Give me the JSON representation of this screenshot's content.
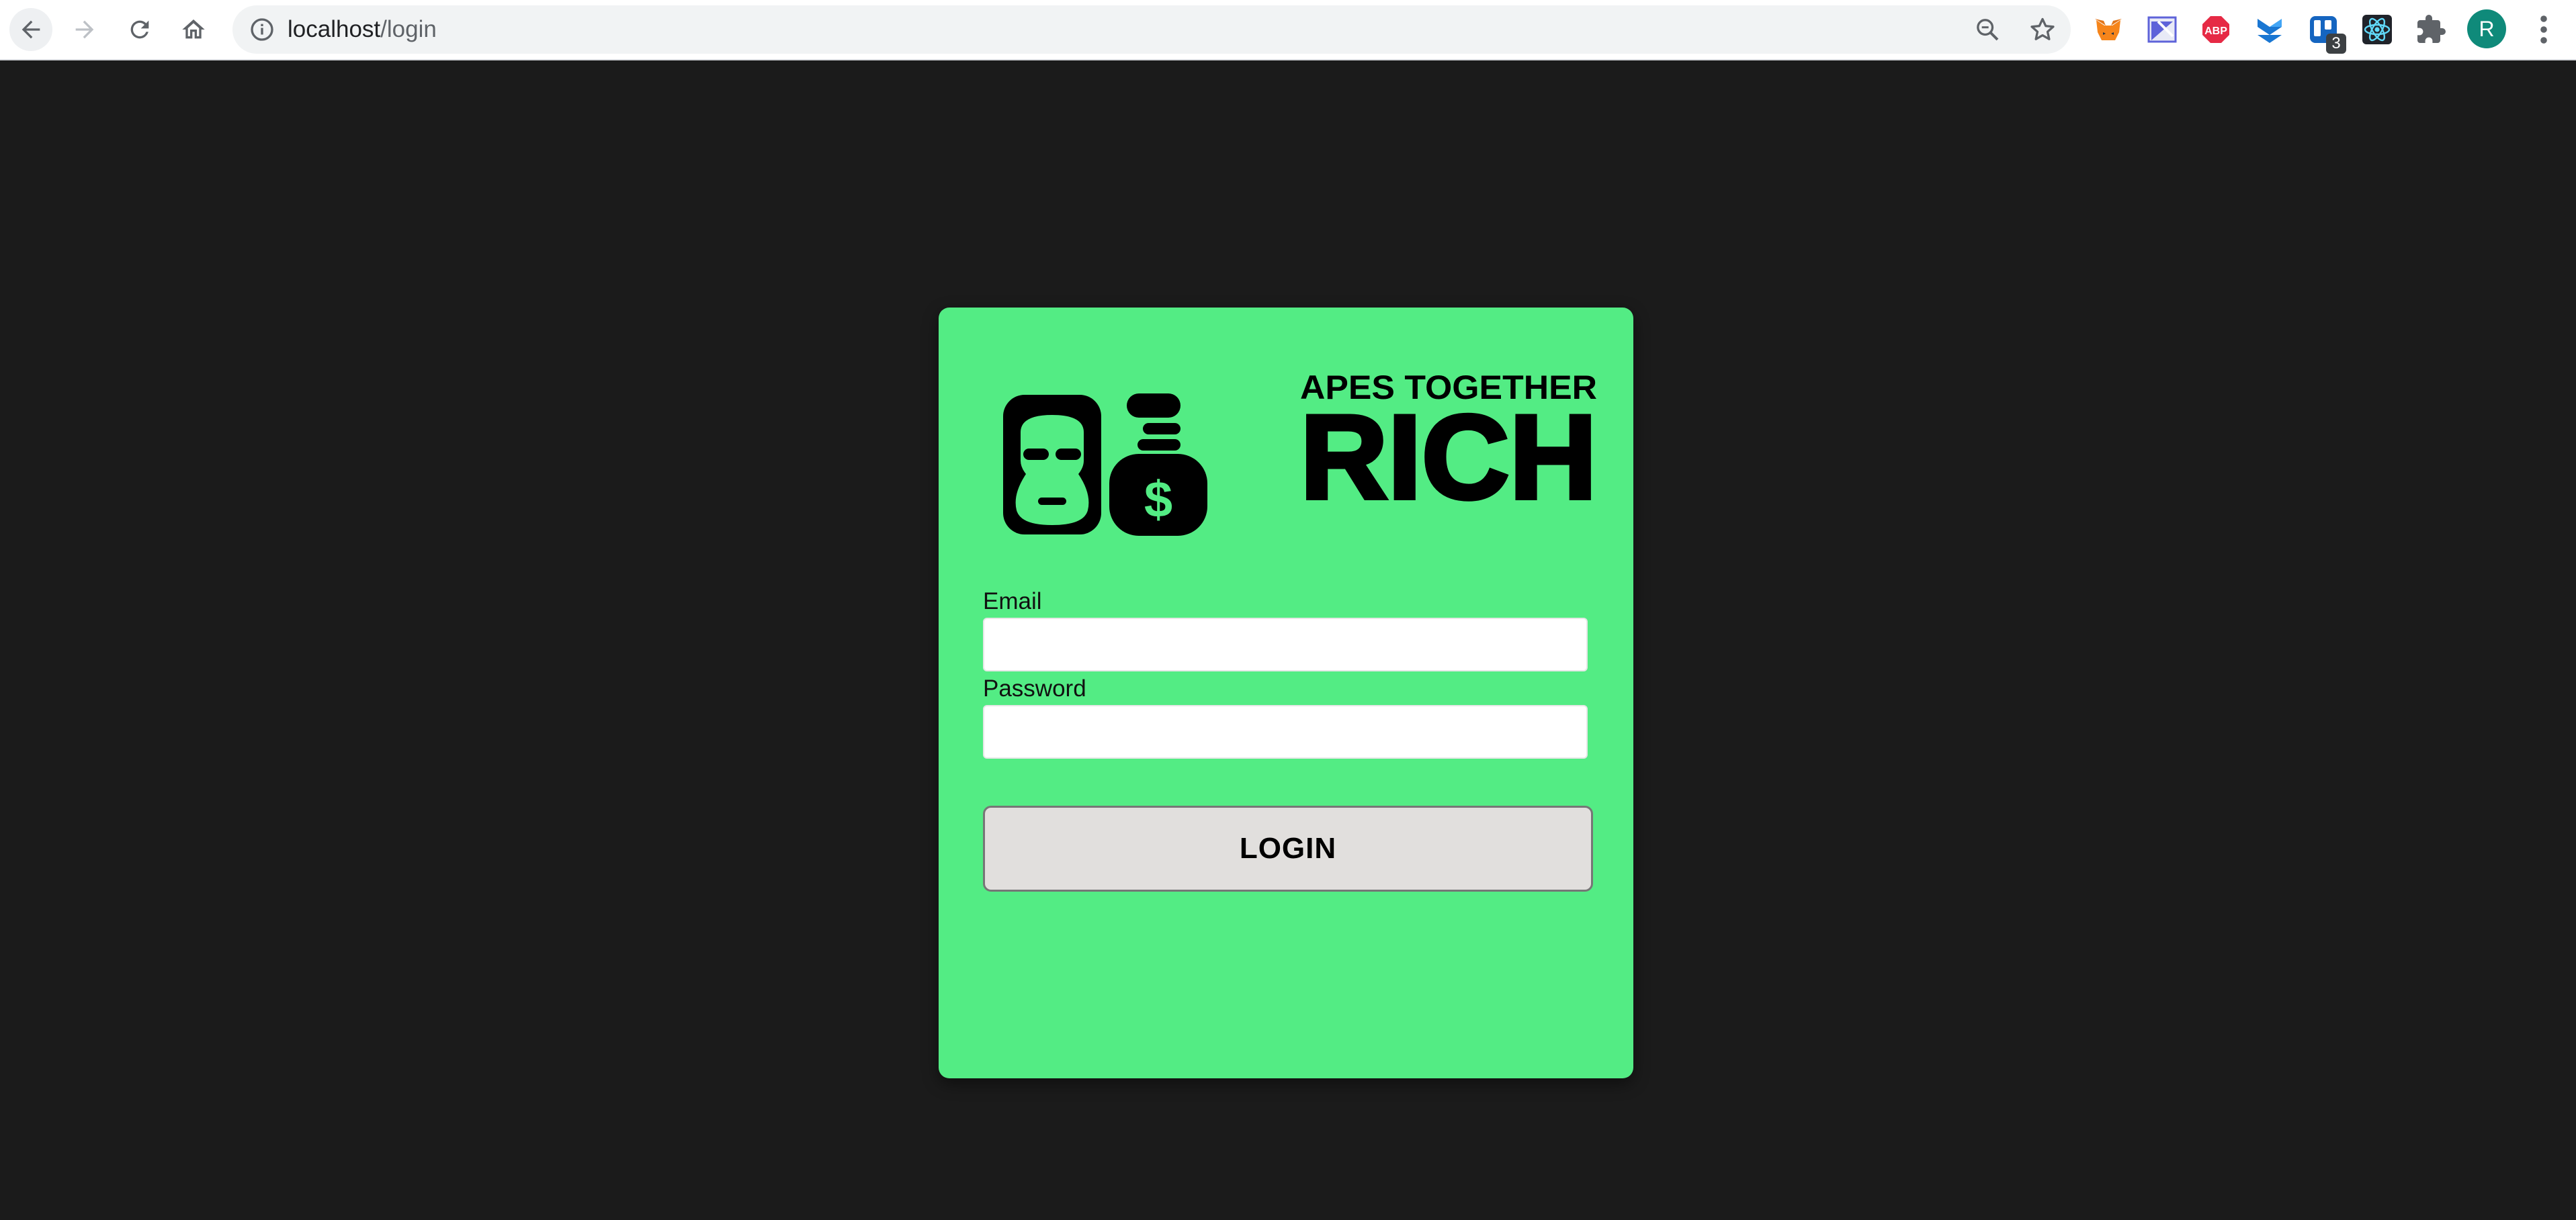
{
  "browser": {
    "url_host": "localhost",
    "url_path": "/login",
    "extensions": [
      {
        "name": "metamask-icon",
        "color": "#e2761b"
      },
      {
        "name": "wappalyzer-icon",
        "color": "#5e63d9"
      },
      {
        "name": "adblock-plus-icon",
        "color": "#e62a45"
      },
      {
        "name": "stackblitz-icon",
        "color": "#1976d2"
      },
      {
        "name": "trello-icon",
        "color": "#1565c0",
        "badge": "3"
      },
      {
        "name": "react-devtools-icon",
        "color": "#61dafb"
      },
      {
        "name": "puzzle-icon",
        "color": "#5f6368"
      }
    ],
    "profile_initial": "R"
  },
  "brand": {
    "tagline": "APES TOGETHER",
    "name": "RICH",
    "money_symbol": "$",
    "colors": {
      "primary": "#53ec84",
      "ink": "#000000",
      "background": "#1b1b1b"
    }
  },
  "form": {
    "email_label": "Email",
    "email_value": "",
    "password_label": "Password",
    "password_value": "",
    "submit_label": "LOGIN"
  }
}
